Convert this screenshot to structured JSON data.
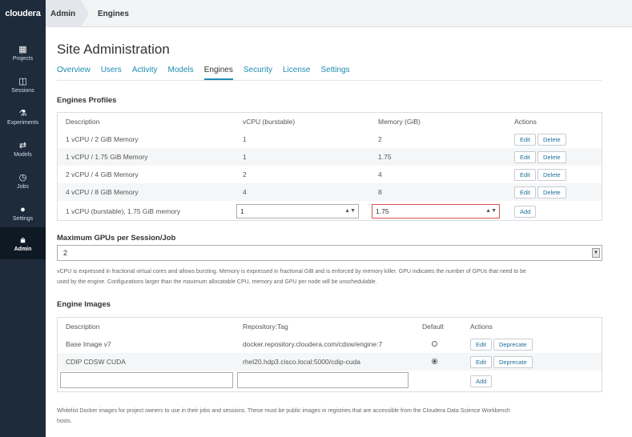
{
  "topbar": {
    "brand": "cloudera",
    "crumb_admin": "Admin",
    "crumb_engines": "Engines"
  },
  "sidebar": {
    "items": [
      {
        "label": "Projects",
        "icon": "grid-icon"
      },
      {
        "label": "Sessions",
        "icon": "sessions-icon"
      },
      {
        "label": "Experiments",
        "icon": "flask-icon"
      },
      {
        "label": "Models",
        "icon": "arrows-icon"
      },
      {
        "label": "Jobs",
        "icon": "clock-icon"
      },
      {
        "label": "Settings",
        "icon": "user-icon"
      },
      {
        "label": "Admin",
        "icon": "lock-icon"
      }
    ]
  },
  "page": {
    "title": "Site Administration",
    "tabs": [
      "Overview",
      "Users",
      "Activity",
      "Models",
      "Engines",
      "Security",
      "License",
      "Settings"
    ],
    "active_tab": "Engines"
  },
  "profiles": {
    "title": "Engines Profiles",
    "headers": [
      "Description",
      "vCPU (burstable)",
      "Memory (GiB)",
      "Actions"
    ],
    "rows": [
      {
        "description": "1 vCPU / 2 GiB Memory",
        "vcpu": "1",
        "memory": "2"
      },
      {
        "description": "1 vCPU / 1.75 GiB Memory",
        "vcpu": "1",
        "memory": "1.75"
      },
      {
        "description": "2 vCPU / 4 GiB Memory",
        "vcpu": "2",
        "memory": "4"
      },
      {
        "description": "4 vCPU / 8 GiB Memory",
        "vcpu": "4",
        "memory": "8"
      }
    ],
    "edit_label": "Edit",
    "delete_label": "Delete",
    "new_row": {
      "description": "1 vCPU (burstable), 1.75 GiB memory",
      "vcpu_value": "1",
      "memory_value": "1.75",
      "add_label": "Add"
    }
  },
  "gpus": {
    "title": "Maximum GPUs per Session/Job",
    "value": "2",
    "help_line1": "vCPU is expressed in fractional virtual cores and allows bursting. Memory is expressed in fractional GiB and is enforced by memory killer. GPU indicates the number of GPUs that need to be",
    "help_line2": "used by the engine. Configurations larger than the maximum allocatable CPU, memory and GPU per node will be unschedulable."
  },
  "images": {
    "title": "Engine Images",
    "headers": [
      "Description",
      "Repository:Tag",
      "Default",
      "Actions"
    ],
    "rows": [
      {
        "description": "Base Image v7",
        "repo": "docker.repository.cloudera.com/cdsw/engine:7",
        "default": false
      },
      {
        "description": "CDIP CDSW CUDA",
        "repo": "rhel20.hdp3.cisco.local:5000/cdip-cuda",
        "default": true
      }
    ],
    "edit_label": "Edit",
    "deprecate_label": "Deprecate",
    "add_label": "Add",
    "help_line1": "Whitelist Docker images for project owners to use in their jobs and sessions. These must be public images in registries that are accessible from the Cloudera Data Science Workbench",
    "help_line2": "hosts."
  }
}
